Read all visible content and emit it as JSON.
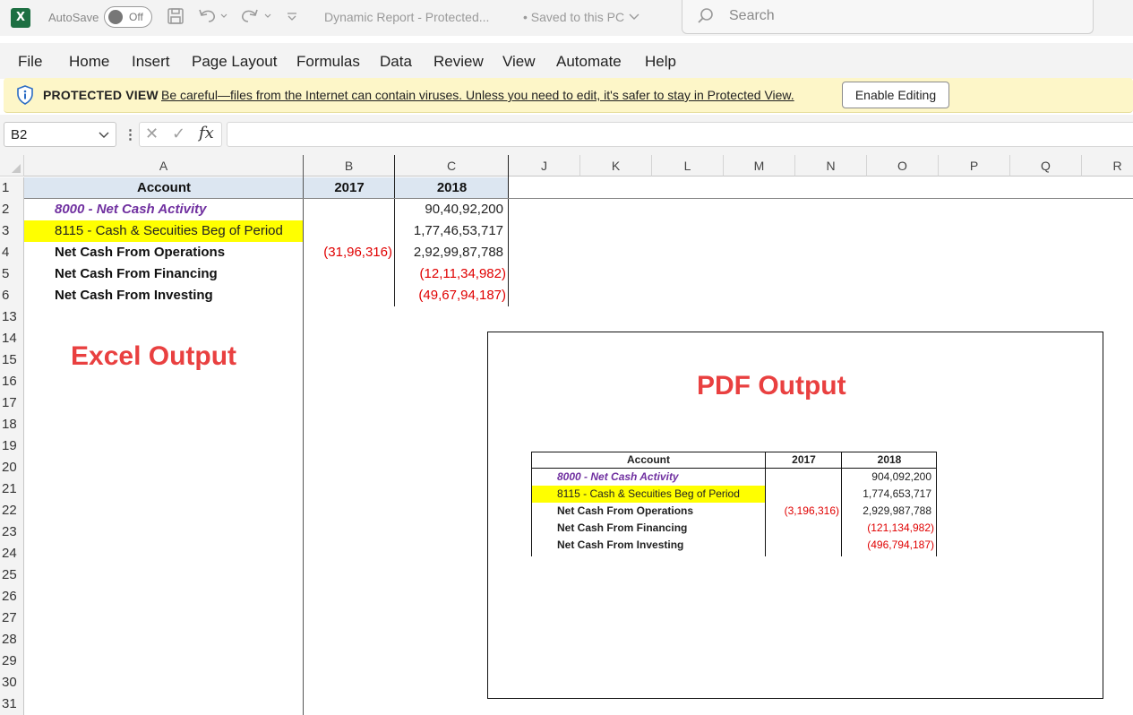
{
  "titlebar": {
    "app_icon": "X",
    "autosave_label": "AutoSave",
    "autosave_state": "Off",
    "doc_title": "Dynamic Report  -  Protected...",
    "saved_status": "• Saved to this PC",
    "search_placeholder": "Search"
  },
  "menu": [
    "File",
    "Home",
    "Insert",
    "Page Layout",
    "Formulas",
    "Data",
    "Review",
    "View",
    "Automate",
    "Help"
  ],
  "protected_view": {
    "label": "PROTECTED VIEW",
    "message": "Be careful—files from the Internet can contain viruses. Unless you need to edit, it's safer to stay in Protected View.",
    "button": "Enable Editing"
  },
  "formula_bar": {
    "name_box": "B2",
    "cancel_symbol": "✕",
    "enter_symbol": "✓",
    "fx_label": "fx",
    "formula": ""
  },
  "grid": {
    "columns": [
      "A",
      "B",
      "C",
      "J",
      "K",
      "L",
      "M",
      "N",
      "O",
      "P",
      "Q",
      "R"
    ],
    "rows": [
      "1",
      "2",
      "3",
      "4",
      "5",
      "6",
      "13",
      "14",
      "15",
      "16",
      "17",
      "18",
      "19",
      "20",
      "21",
      "22",
      "23",
      "24",
      "25",
      "26",
      "27",
      "28",
      "29",
      "30",
      "31"
    ],
    "header": {
      "account": "Account",
      "y2017": "2017",
      "y2018": "2018"
    },
    "data": [
      {
        "account": "8000 - Net Cash Activity",
        "y2017": "",
        "y2018": "90,40,92,200"
      },
      {
        "account": "8115 - Cash & Secuities Beg of Period",
        "y2017": "",
        "y2018": "1,77,46,53,717"
      },
      {
        "account": "Net Cash From Operations",
        "y2017": "(31,96,316)",
        "y2018": "2,92,99,87,788"
      },
      {
        "account": "Net Cash From Financing",
        "y2017": "",
        "y2018": "(12,11,34,982)"
      },
      {
        "account": "Net Cash From Investing",
        "y2017": "",
        "y2018": "(49,67,94,187)"
      }
    ],
    "excel_output_label": "Excel Output"
  },
  "pdf": {
    "title": "PDF Output",
    "header": {
      "account": "Account",
      "y2017": "2017",
      "y2018": "2018"
    },
    "data": [
      {
        "account": "8000 - Net Cash Activity",
        "y2017": "",
        "y2018": "904,092,200"
      },
      {
        "account": "8115 - Cash & Secuities Beg of Period",
        "y2017": "",
        "y2018": "1,774,653,717"
      },
      {
        "account": "Net Cash From Operations",
        "y2017": "(3,196,316)",
        "y2018": "2,929,987,788"
      },
      {
        "account": "Net Cash From Financing",
        "y2017": "",
        "y2018": "(121,134,982)"
      },
      {
        "account": "Net Cash From Investing",
        "y2017": "",
        "y2018": "(496,794,187)"
      }
    ]
  },
  "colors": {
    "accent_red": "#e94040",
    "negative_red": "#e00000",
    "purple": "#7030a0",
    "highlight_yellow": "#ffff00",
    "header_blue": "#dce6f1",
    "banner_yellow": "#fdf6c8"
  }
}
